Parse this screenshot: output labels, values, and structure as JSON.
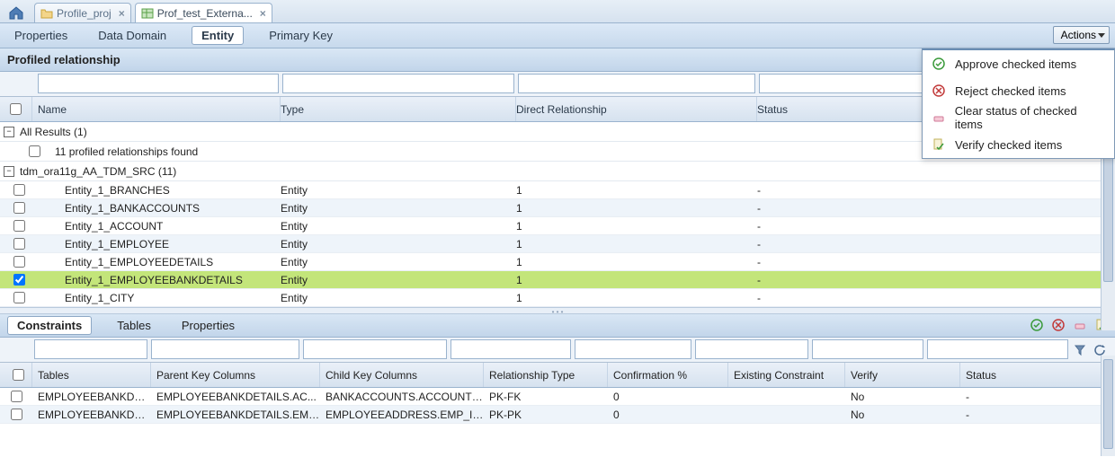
{
  "tabs": {
    "profile_proj": "Profile_proj",
    "prof_test": "Prof_test_Externa..."
  },
  "subnav": {
    "properties": "Properties",
    "data_domain": "Data Domain",
    "entity": "Entity",
    "primary_key": "Primary Key"
  },
  "actions_label": "Actions",
  "actions_menu": {
    "approve": "Approve checked items",
    "reject": "Reject checked items",
    "clear": "Clear status of checked items",
    "verify": "Verify checked items"
  },
  "section_title": "Profiled relationship",
  "main_headers": {
    "name": "Name",
    "type": "Type",
    "dr": "Direct Relationship",
    "status": "Status"
  },
  "groups": {
    "all_results": "All Results (1)",
    "sub_msg": "11 profiled relationships found",
    "src": "tdm_ora11g_AA_TDM_SRC (11)"
  },
  "rows": [
    {
      "name": "Entity_1_BRANCHES",
      "type": "Entity",
      "dr": "1",
      "status": "-",
      "checked": false,
      "alt": false
    },
    {
      "name": "Entity_1_BANKACCOUNTS",
      "type": "Entity",
      "dr": "1",
      "status": "-",
      "checked": false,
      "alt": true
    },
    {
      "name": "Entity_1_ACCOUNT",
      "type": "Entity",
      "dr": "1",
      "status": "-",
      "checked": false,
      "alt": false
    },
    {
      "name": "Entity_1_EMPLOYEE",
      "type": "Entity",
      "dr": "1",
      "status": "-",
      "checked": false,
      "alt": true
    },
    {
      "name": "Entity_1_EMPLOYEEDETAILS",
      "type": "Entity",
      "dr": "1",
      "status": "-",
      "checked": false,
      "alt": false
    },
    {
      "name": "Entity_1_EMPLOYEEBANKDETAILS",
      "type": "Entity",
      "dr": "1",
      "status": "-",
      "checked": true,
      "sel": true
    },
    {
      "name": "Entity_1_CITY",
      "type": "Entity",
      "dr": "1",
      "status": "-",
      "checked": false,
      "alt": false
    }
  ],
  "btabs": {
    "constraints": "Constraints",
    "tables": "Tables",
    "properties": "Properties"
  },
  "cheaders": {
    "tables": "Tables",
    "pk": "Parent Key Columns",
    "ck": "Child Key Columns",
    "rt": "Relationship Type",
    "conf": "Confirmation %",
    "ex": "Existing Constraint",
    "ver": "Verify",
    "status": "Status"
  },
  "crows": [
    {
      "tables": "EMPLOYEEBANKDET...",
      "pk": "EMPLOYEEBANKDETAILS.AC...",
      "ck": "BANKACCOUNTS.ACCOUNT_...",
      "rt": "PK-FK",
      "conf": "0",
      "ex": "",
      "ver": "No",
      "status": "-"
    },
    {
      "tables": "EMPLOYEEBANKDET...",
      "pk": "EMPLOYEEBANKDETAILS.EMP...",
      "ck": "EMPLOYEEADDRESS.EMP_ID...",
      "rt": "PK-PK",
      "conf": "0",
      "ex": "",
      "ver": "No",
      "status": "-"
    }
  ]
}
